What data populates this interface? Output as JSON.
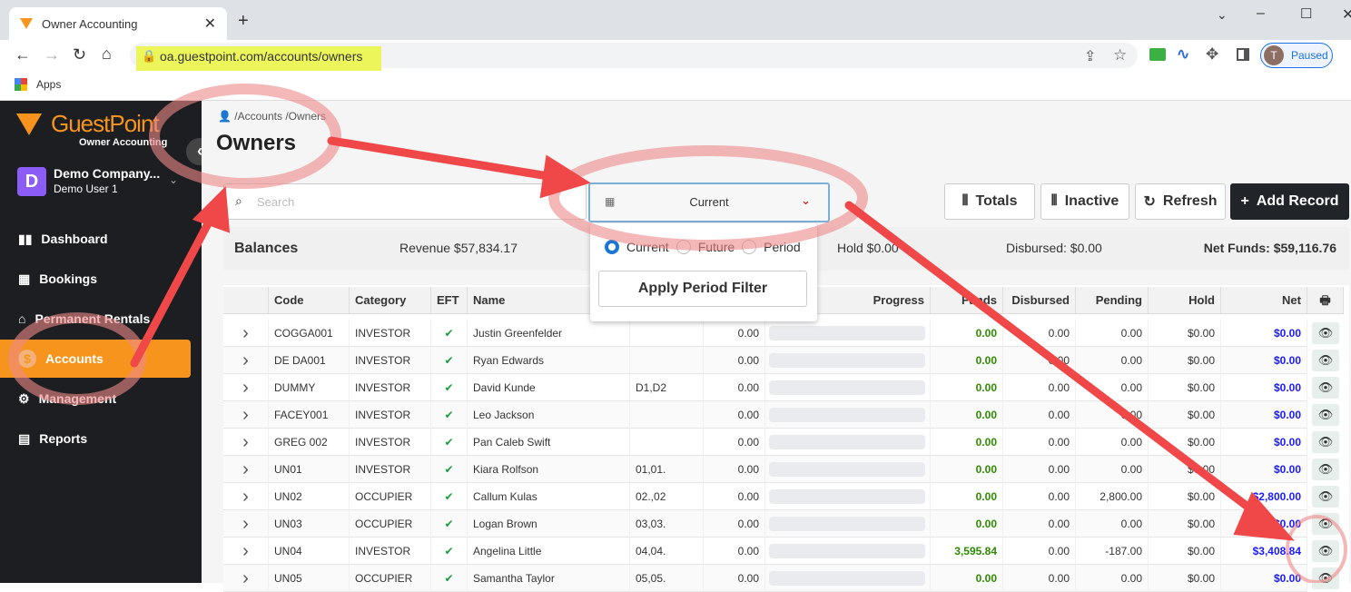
{
  "browser": {
    "tab_title": "Owner Accounting",
    "url": "oa.guestpoint.com/accounts/owners",
    "bookmark_apps": "Apps",
    "profile_initial": "T",
    "profile_status": "Paused"
  },
  "sidebar": {
    "brand": "GuestPoint",
    "brand_sub": "Owner Accounting",
    "company_initial": "D",
    "company": "Demo Company...",
    "user": "Demo User 1",
    "items": [
      {
        "label": "Dashboard",
        "icon": "bar-chart-icon"
      },
      {
        "label": "Bookings",
        "icon": "calendar-icon"
      },
      {
        "label": "Permanent Rentals",
        "icon": "house-user-icon"
      },
      {
        "label": "Accounts",
        "icon": "dollar-icon",
        "active": true
      },
      {
        "label": "Management",
        "icon": "user-gear-icon"
      },
      {
        "label": "Reports",
        "icon": "document-icon"
      }
    ],
    "accent": "#f7941d"
  },
  "page": {
    "breadcrumb": "/Accounts /Owners",
    "title": "Owners"
  },
  "toolbar": {
    "search_placeholder": "Search",
    "period_value": "Current",
    "totals": "Totals",
    "inactive": "Inactive",
    "refresh": "Refresh",
    "add_record": "Add Record"
  },
  "period_popup": {
    "options": [
      "Current",
      "Future",
      "Period"
    ],
    "selected": "Current",
    "apply": "Apply Period Filter"
  },
  "balances": {
    "label": "Balances",
    "revenue": "Revenue $57,834.17",
    "hold": "Hold $0.00",
    "disbursed": "Disbursed: $0.00",
    "net_funds": "Net Funds: $59,116.76"
  },
  "table": {
    "headers": [
      "Code",
      "Category",
      "EFT",
      "Name",
      "",
      "",
      "Progress",
      "Funds",
      "Disbursed",
      "Pending",
      "Hold",
      "Net"
    ],
    "rows": [
      [
        "COGGA001",
        "INVESTOR",
        "Justin Greenfelder",
        "",
        "0.00",
        "0.00",
        "0.00",
        "0.00",
        "$0.00",
        "$0.00"
      ],
      [
        "DE DA001",
        "INVESTOR",
        "Ryan Edwards",
        "",
        "0.00",
        "0.00",
        "0.00",
        "0.00",
        "$0.00",
        "$0.00"
      ],
      [
        "DUMMY",
        "INVESTOR",
        "David Kunde",
        "D1,D2",
        "0.00",
        "0.00",
        "0.00",
        "0.00",
        "$0.00",
        "$0.00"
      ],
      [
        "FACEY001",
        "INVESTOR",
        "Leo Jackson",
        "",
        "0.00",
        "0.00",
        "0.00",
        "0.00",
        "$0.00",
        "$0.00"
      ],
      [
        "GREG 002",
        "INVESTOR",
        "Pan Caleb Swift",
        "",
        "0.00",
        "0.00",
        "0.00",
        "0.00",
        "$0.00",
        "$0.00"
      ],
      [
        "UN01",
        "INVESTOR",
        "Kiara Rolfson",
        "01,01.",
        "0.00",
        "0.00",
        "0.00",
        "0.00",
        "$0.00",
        "$0.00"
      ],
      [
        "UN02",
        "OCCUPIER",
        "Callum Kulas",
        "02.,02",
        "0.00",
        "0.00",
        "0.00",
        "2,800.00",
        "$0.00",
        "$2,800.00"
      ],
      [
        "UN03",
        "OCCUPIER",
        "Logan Brown",
        "03,03.",
        "0.00",
        "0.00",
        "0.00",
        "0.00",
        "$0.00",
        "$0.00"
      ],
      [
        "UN04",
        "INVESTOR",
        "Angelina Little",
        "04,04.",
        "0.00",
        "3,595.84",
        "0.00",
        "-187.00",
        "$0.00",
        "$3,408.84"
      ],
      [
        "UN05",
        "OCCUPIER",
        "Samantha Taylor",
        "05,05.",
        "0.00",
        "0.00",
        "0.00",
        "0.00",
        "$0.00",
        "$0.00"
      ]
    ]
  }
}
